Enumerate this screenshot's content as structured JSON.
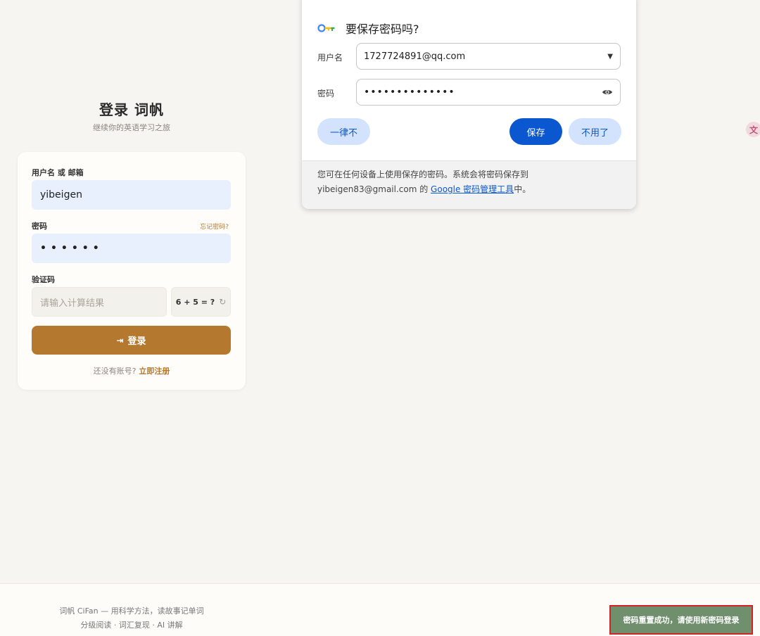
{
  "login": {
    "title": "登录 词帆",
    "subtitle": "继续你的英语学习之旅",
    "username_label": "用户名 或 邮箱",
    "username_value": "yibeigen",
    "password_label": "密码",
    "forgot_label": "忘记密码?",
    "password_dots": "••••••",
    "captcha_label": "验证码",
    "captcha_placeholder": "请输入计算结果",
    "captcha_question": "6 + 5 = ?",
    "login_button": "登录",
    "no_account": "还没有账号?",
    "register_link": "立即注册"
  },
  "save_password_dialog": {
    "title": "要保存密码吗?",
    "username_label": "用户名",
    "username_value": "1727724891@qq.com",
    "password_label": "密码",
    "password_dots": "••••••••••••••",
    "never_button": "一律不",
    "save_button": "保存",
    "no_thanks_button": "不用了",
    "footer_line1": "您可在任何设备上使用保存的密码。系统会将密码保存到",
    "footer_email": "yibeigen83@gmail.com 的 ",
    "footer_link": "Google 密码管理工具",
    "footer_suffix": "中。"
  },
  "icons": {
    "key": "key-icon",
    "eye": "eye-icon",
    "dropdown": "chevron-down-icon",
    "refresh": "refresh-icon",
    "login": "login-arrow-icon",
    "translate": "translate-icon"
  },
  "footer": {
    "tagline": "词帆 CiFan — 用科学方法，读故事记单词",
    "features": "分级阅读 · 词汇复现 · AI 讲解"
  },
  "toast": {
    "message": "密码重置成功，请使用新密码登录"
  },
  "colors": {
    "accent": "#b4792f",
    "google_blue": "#0b57d0",
    "toast_bg": "#6f8f6d",
    "toast_border": "#d4222a"
  }
}
